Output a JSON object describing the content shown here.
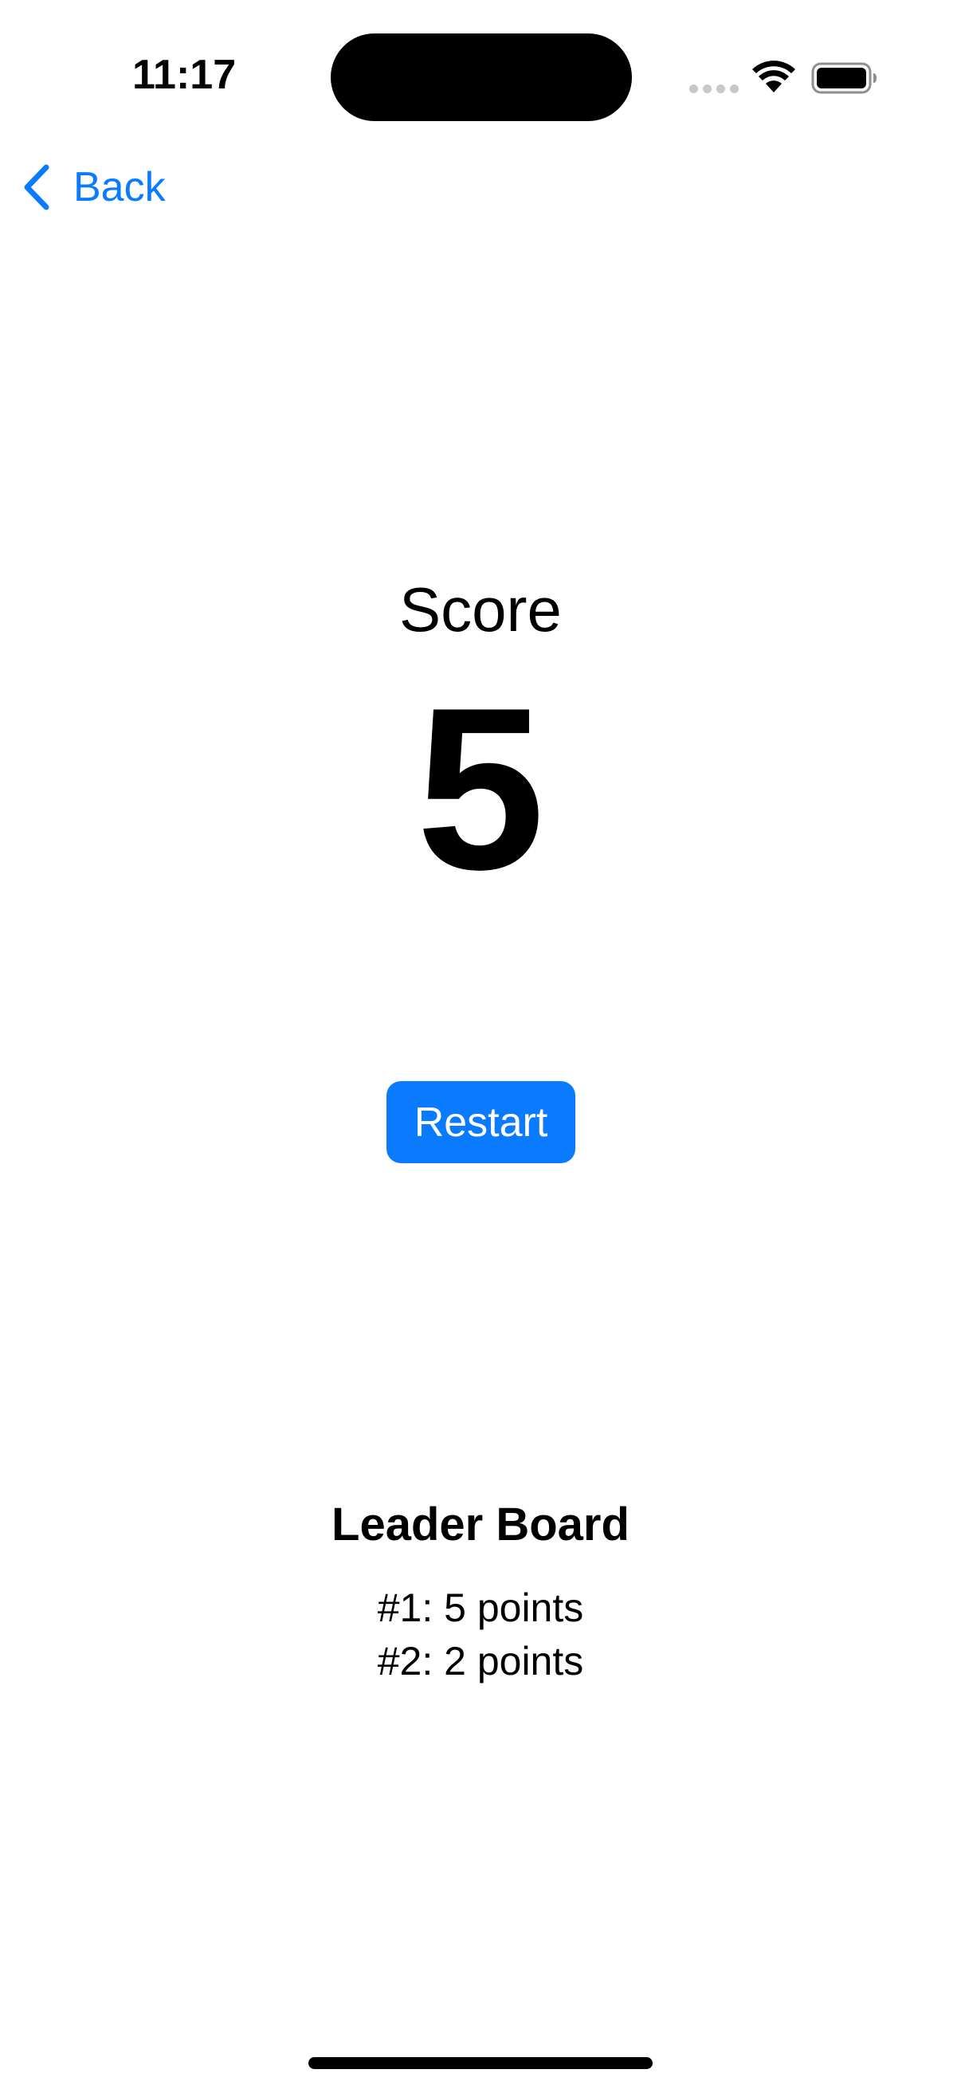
{
  "status_bar": {
    "time": "11:17",
    "icons": [
      "signal-dots-icon",
      "wifi-icon",
      "battery-icon"
    ]
  },
  "nav": {
    "back_label": "Back"
  },
  "score": {
    "label": "Score",
    "value": "5"
  },
  "restart": {
    "label": "Restart"
  },
  "leaderboard": {
    "title": "Leader Board",
    "entries": [
      "#1: 5 points",
      "#2: 2 points"
    ]
  },
  "colors": {
    "accent": "#0a7aff",
    "text": "#000000",
    "background": "#ffffff"
  }
}
